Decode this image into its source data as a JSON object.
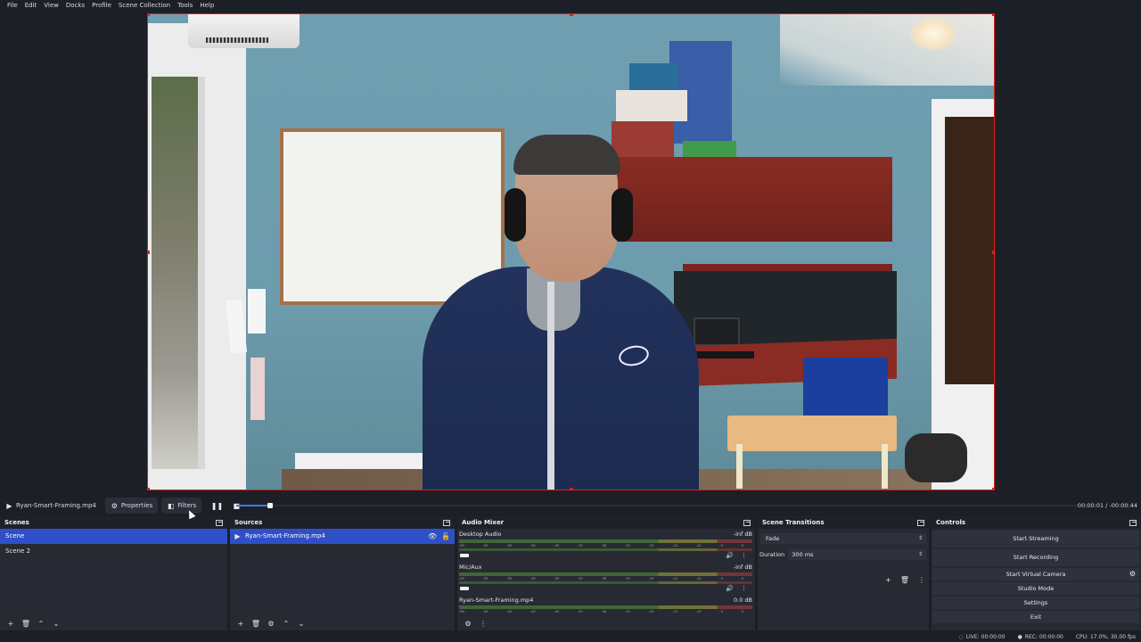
{
  "menu": [
    "File",
    "Edit",
    "View",
    "Docks",
    "Profile",
    "Scene Collection",
    "Tools",
    "Help"
  ],
  "mediabar": {
    "source_name": "Ryan-Smart-Framing.mp4",
    "properties_label": "Properties",
    "filters_label": "Filters",
    "progress": 0.04,
    "time_current": "00:00:01",
    "time_separator": "/",
    "time_remaining": "-00:00:44"
  },
  "scenes": {
    "title": "Scenes",
    "items": [
      "Scene",
      "Scene 2"
    ],
    "selected_index": 0
  },
  "sources": {
    "title": "Sources",
    "items": [
      "Ryan-Smart-Framing.mp4"
    ]
  },
  "mixer": {
    "title": "Audio Mixer",
    "ticks": [
      "-60",
      "-55",
      "-50",
      "-45",
      "-40",
      "-35",
      "-30",
      "-25",
      "-20",
      "-15",
      "-10",
      "-5",
      "0"
    ],
    "channels": [
      {
        "name": "Desktop Audio",
        "level": "-inf dB"
      },
      {
        "name": "Mic/Aux",
        "level": "-inf dB"
      },
      {
        "name": "Ryan-Smart-Framing.mp4",
        "level": "0.0 dB"
      }
    ]
  },
  "transitions": {
    "title": "Scene Transitions",
    "selected": "Fade",
    "duration_label": "Duration",
    "duration_value": "300 ms"
  },
  "controls": {
    "title": "Controls",
    "start_streaming": "Start Streaming",
    "start_recording": "Start Recording",
    "start_virtual_camera": "Start Virtual Camera",
    "studio_mode": "Studio Mode",
    "settings": "Settings",
    "exit": "Exit"
  },
  "status": {
    "live": "LIVE: 00:00:00",
    "rec": "REC: 00:00:00",
    "cpu": "CPU: 17.0%, 30.00 fps"
  },
  "colors": {
    "accent": "#2f4fc7",
    "selection_border": "#e01d1d",
    "panel": "#272a33",
    "background": "#1d1f26"
  },
  "icons": {
    "play": "play-icon",
    "pause": "pause-icon",
    "stop": "stop-icon",
    "gear": "gear-icon",
    "filter": "filter-icon",
    "add": "add-icon",
    "trash": "trash-icon",
    "up": "chevron-up-icon",
    "down": "chevron-down-icon",
    "eye": "eye-icon",
    "lock": "lock-icon",
    "speaker": "speaker-icon",
    "menu": "more-vertical-icon"
  }
}
